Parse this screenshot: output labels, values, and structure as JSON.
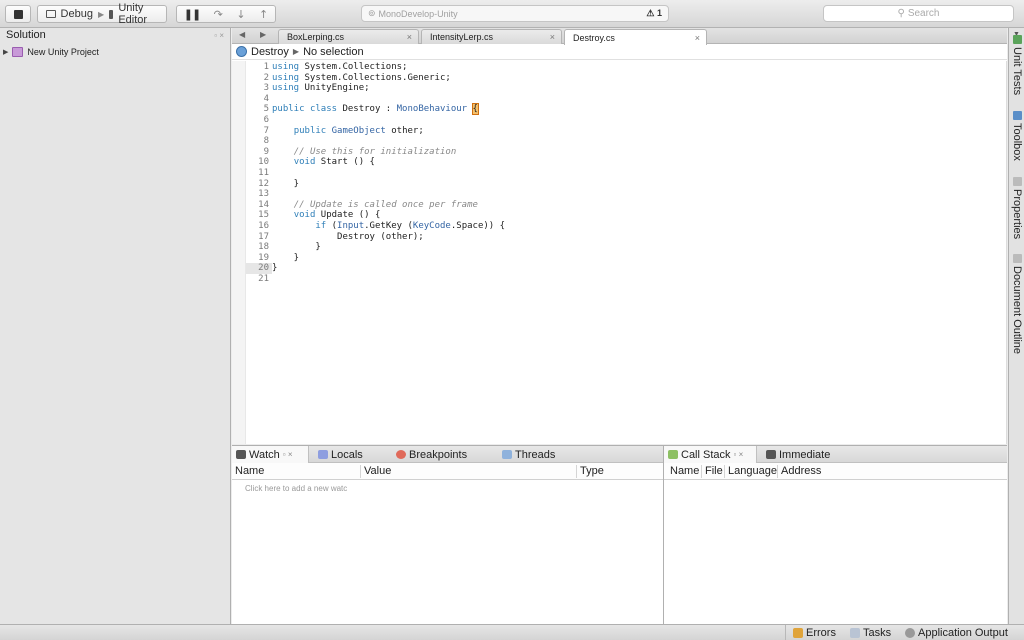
{
  "toolbar": {
    "config": "Debug",
    "device": "Unity Editor",
    "status_text": "MonoDevelop-Unity",
    "warning_count": "⚠ 1",
    "search_placeholder": "Search"
  },
  "solution": {
    "title": "Solution",
    "project": "New Unity Project"
  },
  "tabs": [
    {
      "label": "BoxLerping.cs"
    },
    {
      "label": "IntensityLerp.cs"
    },
    {
      "label": "Destroy.cs"
    }
  ],
  "pathbar": {
    "class_name": "Destroy",
    "member": "No selection"
  },
  "code": {
    "current_line": 20,
    "lines": [
      "using System.Collections;",
      "using System.Collections.Generic;",
      "using UnityEngine;",
      "",
      "public class Destroy : MonoBehaviour {",
      "",
      "    public GameObject other;",
      "",
      "    // Use this for initialization",
      "    void Start () {",
      "",
      "    }",
      "",
      "    // Update is called once per frame",
      "    void Update () {",
      "        if (Input.GetKey (KeyCode.Space)) {",
      "            Destroy (other);",
      "        }",
      "    }",
      "}",
      ""
    ]
  },
  "watch_pad": {
    "tabs": [
      "Watch",
      "Locals",
      "Breakpoints",
      "Threads"
    ],
    "columns": [
      "Name",
      "Value",
      "Type"
    ],
    "hint": "Click here to add a new watc"
  },
  "callstack_pad": {
    "tabs": [
      "Call Stack",
      "Immediate"
    ],
    "columns": [
      "Name",
      "File",
      "Language",
      "Address"
    ]
  },
  "dock": {
    "items": [
      "Unit Tests",
      "Toolbox",
      "Properties",
      "Document Outline"
    ]
  },
  "statusbar": {
    "errors": "Errors",
    "tasks": "Tasks",
    "output": "Application Output"
  },
  "colors": {
    "keyword": "#2f7fb8",
    "comment": "#888888",
    "brace_highlight": "#f5c16c"
  }
}
